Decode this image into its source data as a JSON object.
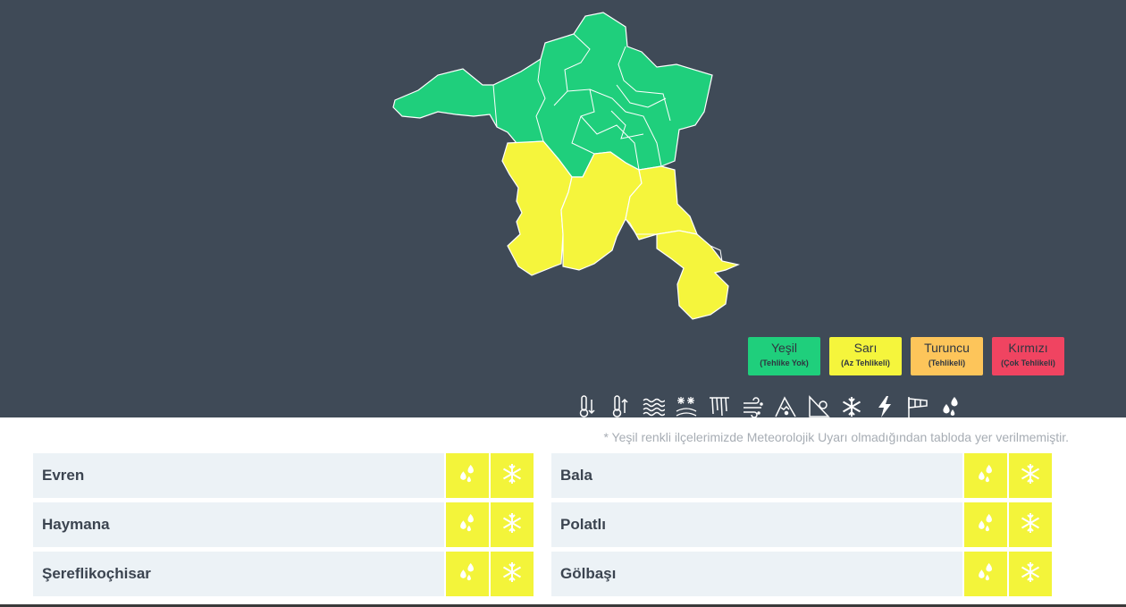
{
  "colors": {
    "background_top": "#3f4a57",
    "green": "#1fcf7c",
    "yellow": "#f5f53c",
    "orange": "#fdc55a",
    "red": "#f04461"
  },
  "legend": [
    {
      "name": "Yeşil",
      "sub": "(Tehlike Yok)",
      "color": "#1fcf7c"
    },
    {
      "name": "Sarı",
      "sub": "(Az Tehlikeli)",
      "color": "#f5f53c"
    },
    {
      "name": "Turuncu",
      "sub": "(Tehlikeli)",
      "color": "#fdc55a"
    },
    {
      "name": "Kırmızı",
      "sub": "(Çok Tehlikeli)",
      "color": "#f04461"
    }
  ],
  "hazard_icons": [
    "cold-icon",
    "heat-icon",
    "fog-icon",
    "snow-ice-icon",
    "frost-icon",
    "dust-storm-icon",
    "avalanche-icon",
    "landslide-icon",
    "snow-icon",
    "lightning-icon",
    "wind-icon",
    "rain-icon"
  ],
  "note": "* Yeşil renkli ilçelerimizde Meteorolojik Uyarı olmadığından tabloda yer verilmemiştir.",
  "districts_left": [
    {
      "name": "Evren",
      "warnings": [
        "rain-icon",
        "snow-icon"
      ]
    },
    {
      "name": "Haymana",
      "warnings": [
        "rain-icon",
        "snow-icon"
      ]
    },
    {
      "name": "Şereflikoçhisar",
      "warnings": [
        "rain-icon",
        "snow-icon"
      ]
    }
  ],
  "districts_right": [
    {
      "name": "Bala",
      "warnings": [
        "rain-icon",
        "snow-icon"
      ]
    },
    {
      "name": "Polatlı",
      "warnings": [
        "rain-icon",
        "snow-icon"
      ]
    },
    {
      "name": "Gölbaşı",
      "warnings": [
        "rain-icon",
        "snow-icon"
      ]
    }
  ]
}
